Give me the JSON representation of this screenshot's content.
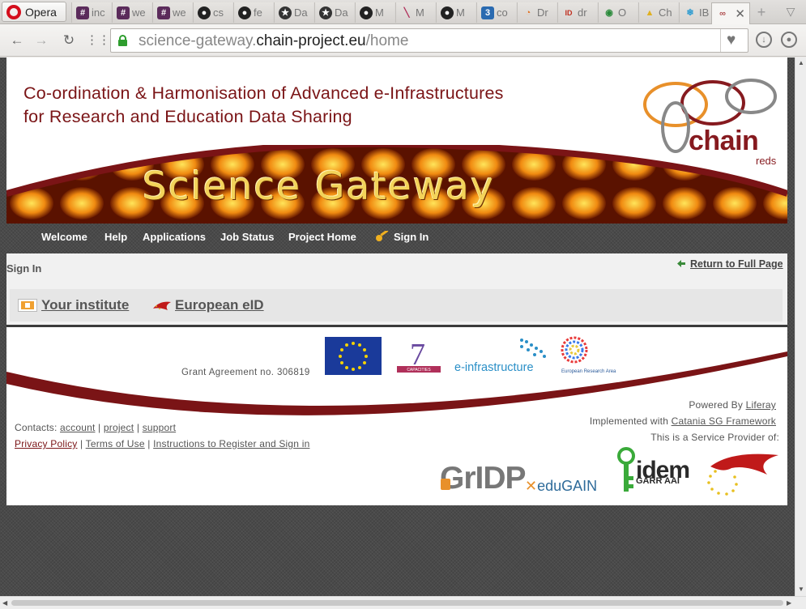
{
  "browser": {
    "opera_label": "Opera",
    "tabs": [
      {
        "icon": "hash-icon",
        "label": "inc"
      },
      {
        "icon": "hash-icon",
        "label": "we"
      },
      {
        "icon": "hash-icon",
        "label": "we"
      },
      {
        "icon": "github-icon",
        "label": "cs"
      },
      {
        "icon": "github-icon",
        "label": "fe"
      },
      {
        "icon": "star-icon",
        "label": "Da"
      },
      {
        "icon": "star-icon",
        "label": "Da"
      },
      {
        "icon": "github-icon",
        "label": "M"
      },
      {
        "icon": "pen-icon",
        "label": "M"
      },
      {
        "icon": "github-icon",
        "label": "M"
      },
      {
        "icon": "css-icon",
        "label": "co"
      },
      {
        "icon": "chart-icon",
        "label": "Dr"
      },
      {
        "icon": "id-icon",
        "label": "dr"
      },
      {
        "icon": "chrome-icon",
        "label": "O"
      },
      {
        "icon": "drive-icon",
        "label": "Ch"
      },
      {
        "icon": "snowflake-icon",
        "label": "IB"
      },
      {
        "icon": "chain-icon",
        "label": ""
      }
    ],
    "url_prefix": "science-gateway.",
    "url_domain": "chain-project.eu",
    "url_path": "/home"
  },
  "header": {
    "title_line1": "Co-ordination & Harmonisation of Advanced e-Infrastructures",
    "title_line2": "for Research and Education Data Sharing",
    "logo_text": "chain",
    "logo_sub": "reds",
    "banner_text": "Science Gateway"
  },
  "menu": {
    "items": [
      "Welcome",
      "Help",
      "Applications",
      "Job Status",
      "Project Home"
    ],
    "sign_in": "Sign In"
  },
  "signin": {
    "heading": "Sign In",
    "return_link": "Return to Full Page",
    "idp_options": [
      "Your institute",
      "European eID"
    ]
  },
  "footer": {
    "grant": "Grant Agreement no. 306819",
    "einfra_label": "e-infrastructure",
    "era_label": "European Research Area",
    "powered_by": "Powered By",
    "liferay": "Liferay",
    "implemented_with": "Implemented with",
    "catania": "Catania SG Framework",
    "service_provider": "This is a Service Provider of:",
    "contacts_label": "Contacts:",
    "contacts": [
      "account",
      "project",
      "support"
    ],
    "policy_links": [
      "Privacy Policy",
      "Terms of Use",
      "Instructions to Register and Sign in"
    ],
    "logos": {
      "gridp": "GrIDP",
      "edugain": "eduGAIN",
      "idem": "idem",
      "garr": "GARR AAI"
    }
  },
  "colors": {
    "brand_red": "#7a1416",
    "secure_green": "#2e9d2e"
  }
}
